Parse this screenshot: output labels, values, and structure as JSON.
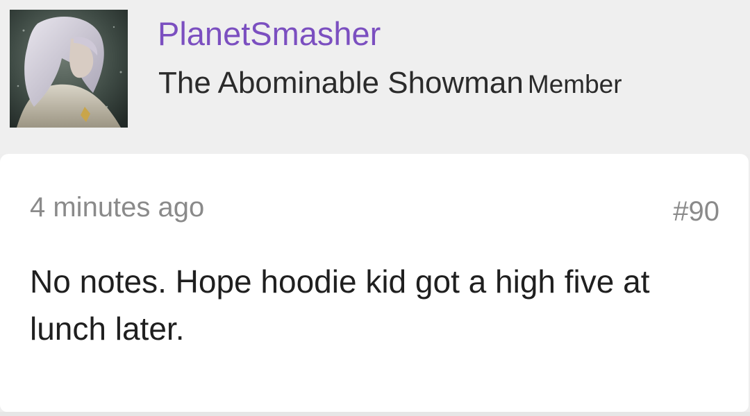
{
  "post": {
    "author": {
      "username": "PlanetSmasher",
      "title": "The Abominable Showman",
      "role": "Member"
    },
    "timestamp": "4 minutes ago",
    "post_number": "#90",
    "message": "No notes. Hope hoodie kid got a high five at lunch later."
  },
  "colors": {
    "username": "#7b4fc0",
    "header_bg": "#efefef",
    "card_bg": "#ffffff",
    "meta_text": "#8a8a8a"
  }
}
